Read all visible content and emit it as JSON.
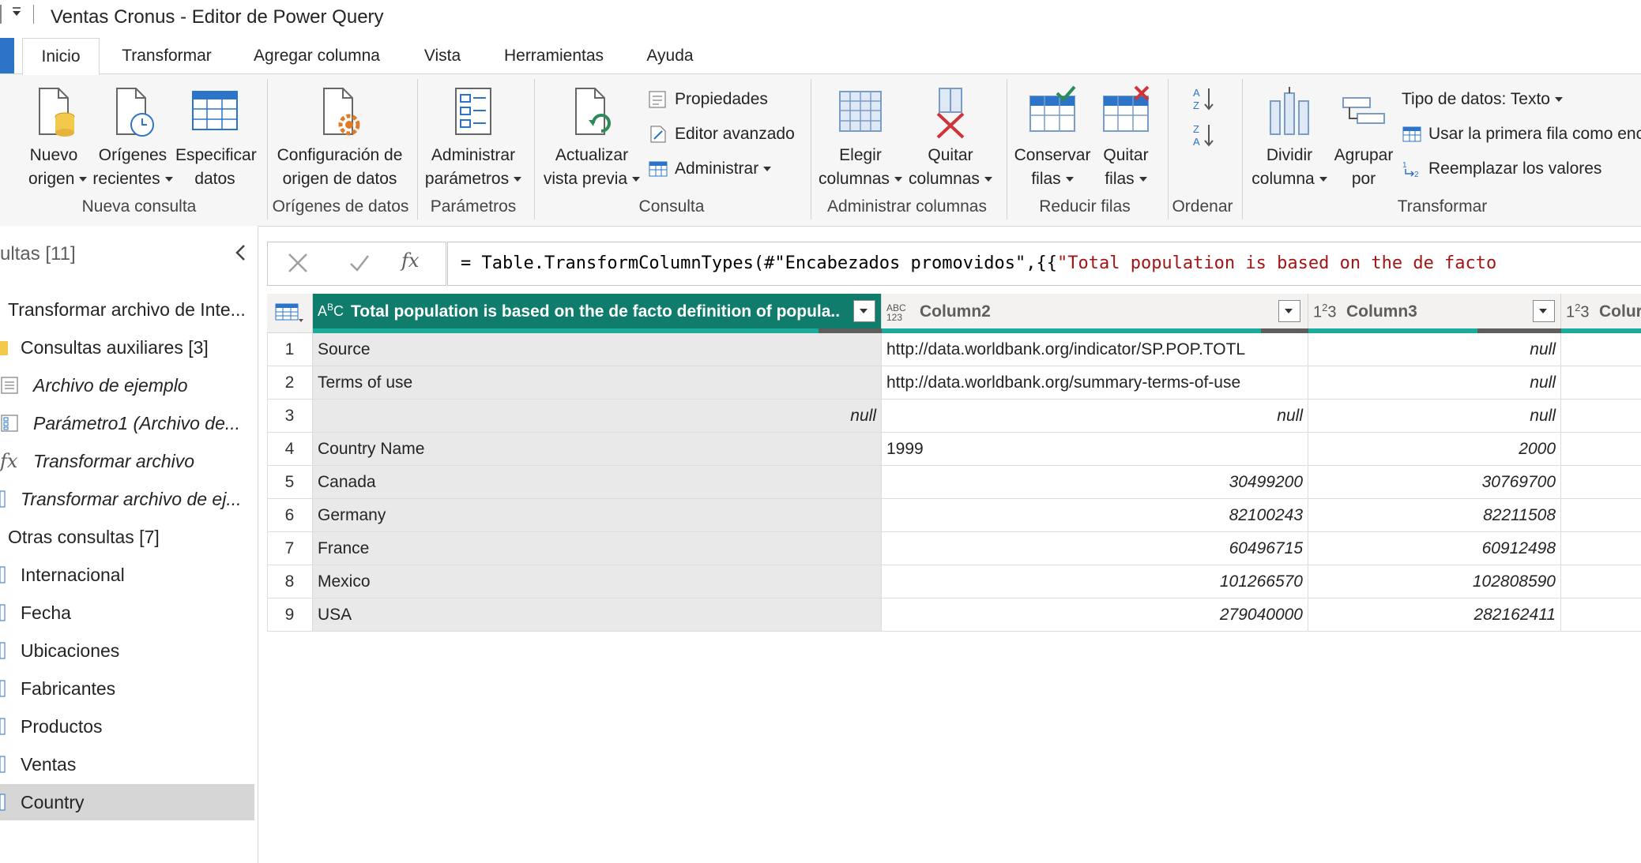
{
  "window": {
    "title": "Ventas Cronus - Editor de Power Query"
  },
  "tabs": [
    "Inicio",
    "Transformar",
    "Agregar columna",
    "Vista",
    "Herramientas",
    "Ayuda"
  ],
  "ribbon": {
    "nueva_consulta": {
      "label": "Nueva consulta",
      "nuevo_origen": [
        "Nuevo",
        "origen"
      ],
      "origenes_recientes": [
        "Orígenes",
        "recientes"
      ],
      "especificar_datos": [
        "Especificar",
        "datos"
      ]
    },
    "origenes_datos": {
      "label": "Orígenes de datos",
      "configuracion": [
        "Configuración de",
        "origen de datos"
      ]
    },
    "parametros": {
      "label": "Parámetros",
      "administrar": [
        "Administrar",
        "parámetros"
      ]
    },
    "consulta": {
      "label": "Consulta",
      "actualizar": [
        "Actualizar",
        "vista previa"
      ],
      "propiedades": "Propiedades",
      "editor_avanzado": "Editor avanzado",
      "administrar": "Administrar"
    },
    "administrar_columnas": {
      "label": "Administrar columnas",
      "elegir": [
        "Elegir",
        "columnas"
      ],
      "quitar": [
        "Quitar",
        "columnas"
      ]
    },
    "reducir_filas": {
      "label": "Reducir filas",
      "conservar": [
        "Conservar",
        "filas"
      ],
      "quitar": [
        "Quitar",
        "filas"
      ]
    },
    "ordenar": {
      "label": "Ordenar"
    },
    "transformar": {
      "label": "Transformar",
      "dividir": [
        "Dividir",
        "columna"
      ],
      "agrupar": [
        "Agrupar",
        "por"
      ],
      "tipo_datos": "Tipo de datos: Texto",
      "primera_fila": "Usar la primera fila como enc",
      "reemplazar": "Reemplazar los valores"
    }
  },
  "query_pane": {
    "title": "ultas [11]",
    "items": [
      {
        "label": "Transformar archivo de Inte...",
        "style": "group"
      },
      {
        "label": "Consultas auxiliares [3]",
        "style": "folder"
      },
      {
        "label": "Archivo de ejemplo",
        "style": "italic"
      },
      {
        "label": "Parámetro1 (Archivo de...",
        "style": "italic"
      },
      {
        "label": "Transformar archivo",
        "style": "italic-fx"
      },
      {
        "label": "Transformar archivo de ej...",
        "style": "italic"
      },
      {
        "label": "Otras consultas [7]",
        "style": "group"
      },
      {
        "label": "Internacional",
        "style": "table"
      },
      {
        "label": "Fecha",
        "style": "table"
      },
      {
        "label": "Ubicaciones",
        "style": "table"
      },
      {
        "label": "Fabricantes",
        "style": "table"
      },
      {
        "label": "Productos",
        "style": "table"
      },
      {
        "label": "Ventas",
        "style": "table"
      },
      {
        "label": "Country",
        "style": "table-selected"
      }
    ]
  },
  "formula": {
    "prefix": "= Table.TransformColumnTypes(#\"Encabezados promovidos\",{{",
    "string": "\"Total population is based on the de facto"
  },
  "grid": {
    "columns": [
      {
        "type": "ABC",
        "name": "Total population is based on the de facto definition of popula..."
      },
      {
        "type": "ABC/123",
        "name": "Column2"
      },
      {
        "type": "123",
        "name": "Column3"
      },
      {
        "type": "123",
        "name": "Colur"
      }
    ],
    "rows": [
      {
        "n": "1",
        "c1": "Source",
        "c2": "http://data.worldbank.org/indicator/SP.POP.TOTL",
        "c3": "null"
      },
      {
        "n": "2",
        "c1": "Terms of use",
        "c2": "http://data.worldbank.org/summary-terms-of-use",
        "c3": "null"
      },
      {
        "n": "3",
        "c1": "null",
        "c2": "null",
        "c3": "null"
      },
      {
        "n": "4",
        "c1": "Country Name",
        "c2": "1999",
        "c3": "2000"
      },
      {
        "n": "5",
        "c1": "Canada",
        "c2": "30499200",
        "c3": "30769700"
      },
      {
        "n": "6",
        "c1": "Germany",
        "c2": "82100243",
        "c3": "82211508"
      },
      {
        "n": "7",
        "c1": "France",
        "c2": "60496715",
        "c3": "60912498"
      },
      {
        "n": "8",
        "c1": "Mexico",
        "c2": "101266570",
        "c3": "102808590"
      },
      {
        "n": "9",
        "c1": "USA",
        "c2": "279040000",
        "c3": "282162411"
      }
    ]
  },
  "colors": {
    "accent": "#107c6b",
    "quality_bar": "#1aab9b",
    "selected_row": "#d6d6d6"
  }
}
